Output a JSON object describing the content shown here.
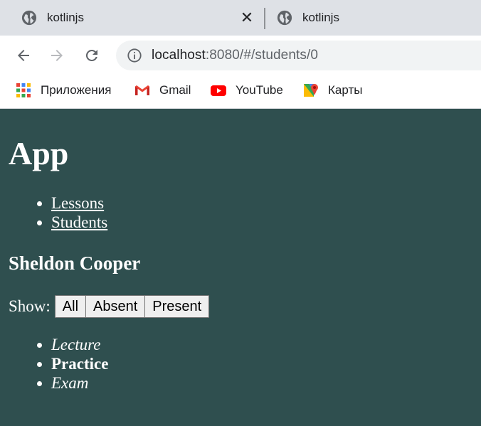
{
  "browser": {
    "tabs": [
      {
        "title": "kotlinjs",
        "active": true,
        "close_label": "✕"
      },
      {
        "title": "kotlinjs",
        "active": false
      }
    ],
    "url_host": "localhost",
    "url_rest": ":8080/#/students/0",
    "bookmarks": [
      {
        "label": "Приложения",
        "icon": "apps-grid-icon"
      },
      {
        "label": "Gmail",
        "icon": "gmail-icon"
      },
      {
        "label": "YouTube",
        "icon": "youtube-icon"
      },
      {
        "label": "Карты",
        "icon": "maps-icon"
      }
    ]
  },
  "app": {
    "title": "App",
    "nav": [
      "Lessons",
      "Students"
    ],
    "student_name": "Sheldon Cooper",
    "filter": {
      "label": "Show:",
      "options": [
        "All",
        "Absent",
        "Present"
      ]
    },
    "lessons": [
      {
        "name": "Lecture",
        "status": "absent"
      },
      {
        "name": "Practice",
        "status": "present"
      },
      {
        "name": "Exam",
        "status": "absent"
      }
    ]
  },
  "colors": {
    "page_background": "#2f4f4f",
    "tabstrip_background": "#dee1e6",
    "text": "#ffffff"
  }
}
